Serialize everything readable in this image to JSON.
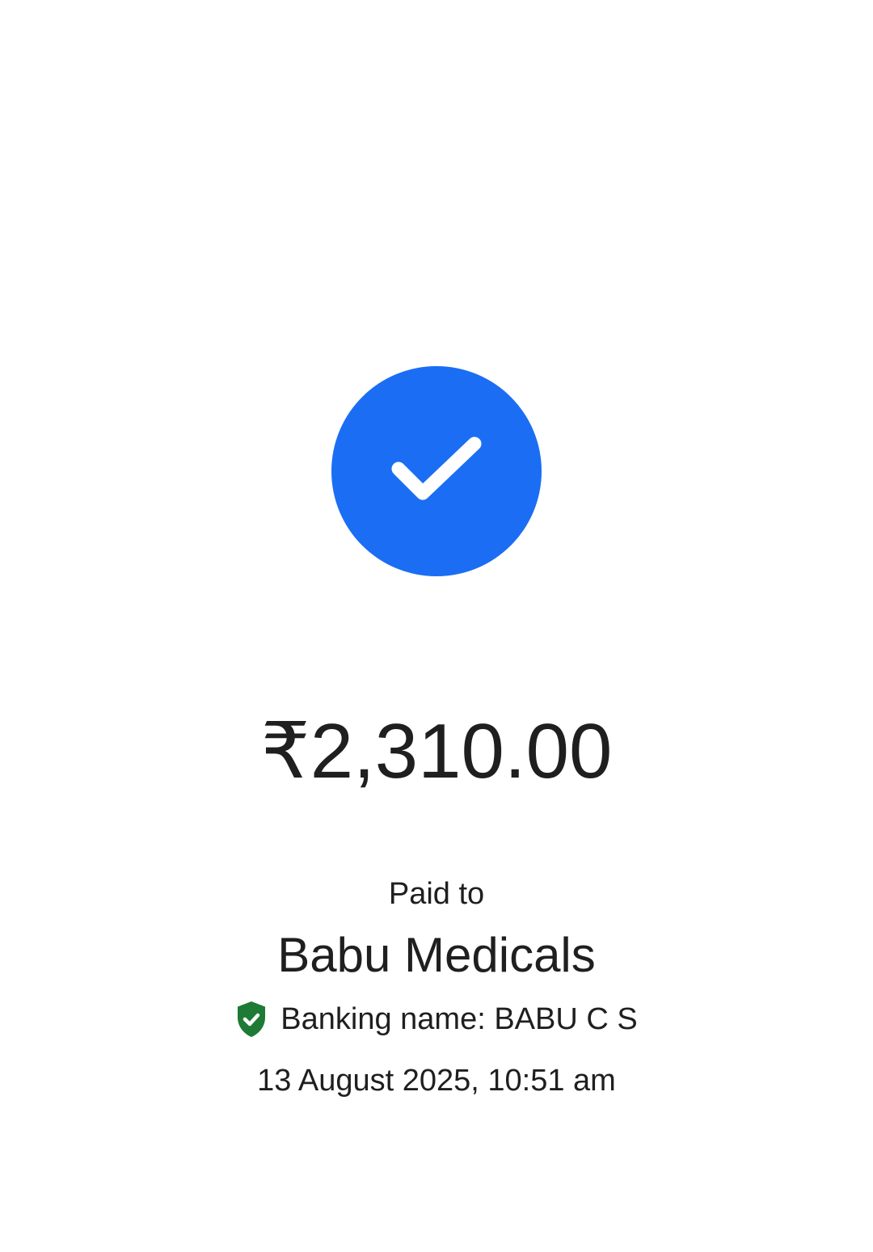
{
  "status": {
    "icon": "checkmark-icon",
    "color": "#1b6ef3"
  },
  "payment": {
    "amount": "₹2,310.00",
    "paid_to_label": "Paid to",
    "payee_name": "Babu Medicals",
    "banking_name": "Banking name: BABU C S",
    "verified_icon": "verified-shield-icon",
    "verified_color": "#1e7a34",
    "timestamp": "13 August 2025, 10:51 am"
  }
}
